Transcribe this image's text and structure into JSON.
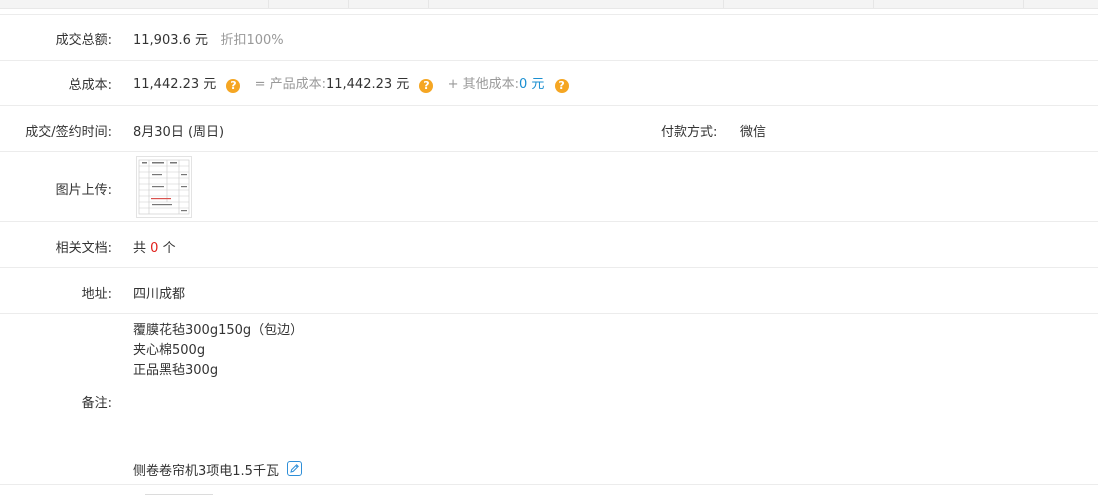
{
  "deal_total": {
    "label": "成交总额:",
    "amount": "11,903.6 元",
    "discount": "折扣100%"
  },
  "total_cost": {
    "label": "总成本:",
    "amount": "11,442.23 元",
    "equals_label": "= 产品成本:",
    "product_cost": "11,442.23 元",
    "plus_label": "+ 其他成本:",
    "other_cost": "0 元"
  },
  "sign_time": {
    "label": "成交/签约时间:",
    "value": "8月30日 (周日)"
  },
  "payment": {
    "label": "付款方式:",
    "value": "微信"
  },
  "image_upload": {
    "label": "图片上传:"
  },
  "documents": {
    "label": "相关文档:",
    "prefix": "共",
    "count": "0",
    "suffix": "个"
  },
  "address": {
    "label": "地址:",
    "value": "四川成都"
  },
  "remarks": {
    "label": "备注:",
    "lines": [
      "覆膜花毡300g150g（包边）",
      "夹心棉500g",
      "正品黑毡300g"
    ],
    "last_line": "侧卷卷帘机3项电1.5千瓦"
  },
  "icons": {
    "help": "question-circle-icon",
    "edit": "pencil-edit-icon"
  },
  "colors": {
    "help_icon": "#f5a623",
    "link": "#1a8fd1",
    "count": "#e0201b"
  }
}
